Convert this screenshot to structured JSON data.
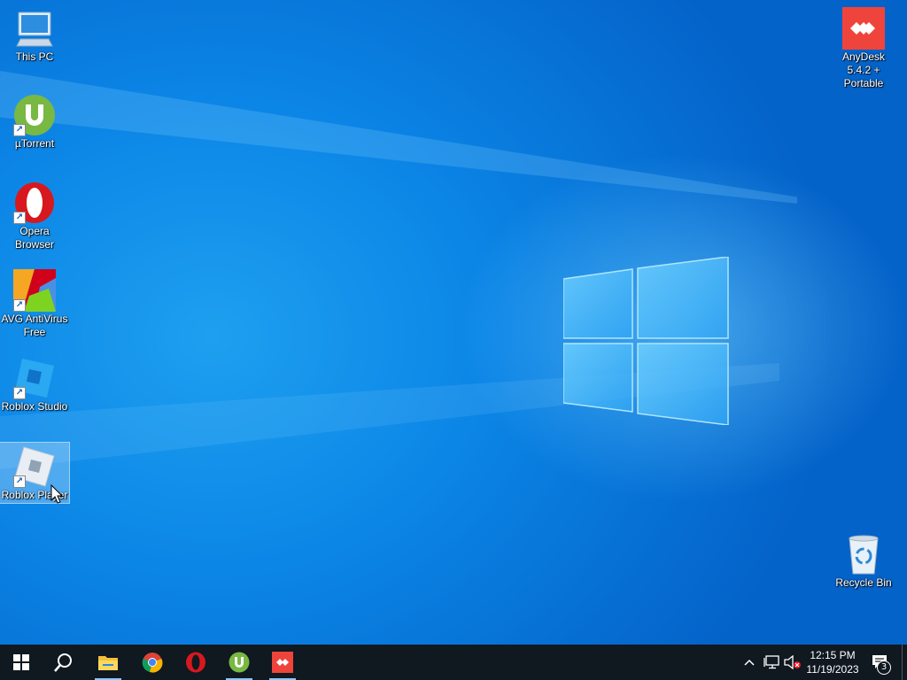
{
  "desktop": {
    "icons_left": [
      {
        "label": "This PC",
        "icon": "this-pc-icon"
      },
      {
        "label": "µTorrent",
        "icon": "utorrent-icon"
      },
      {
        "label": "Opera Browser",
        "icon": "opera-icon"
      },
      {
        "label": "AVG AntiVirus Free",
        "icon": "avg-icon"
      },
      {
        "label": "Roblox Studio",
        "icon": "roblox-studio-icon"
      },
      {
        "label": "Roblox Player",
        "icon": "roblox-player-icon",
        "selected": true
      }
    ],
    "icons_right": [
      {
        "label": "AnyDesk 5.4.2 + Portable",
        "icon": "anydesk-icon"
      },
      {
        "label": "Recycle Bin",
        "icon": "recycle-bin-icon"
      }
    ]
  },
  "taskbar": {
    "apps": [
      "start-icon",
      "search-icon",
      "file-explorer-icon",
      "chrome-icon",
      "opera-icon",
      "utorrent-icon",
      "anydesk-icon"
    ],
    "clock": {
      "time": "12:15 PM",
      "date": "11/19/2023"
    },
    "notifications_count": "3"
  },
  "colors": {
    "accent": "#0a7fe0",
    "taskbar": "#101820",
    "anydesk": "#ef443b",
    "utorrent": "#78b843",
    "opera": "#d7181f"
  }
}
